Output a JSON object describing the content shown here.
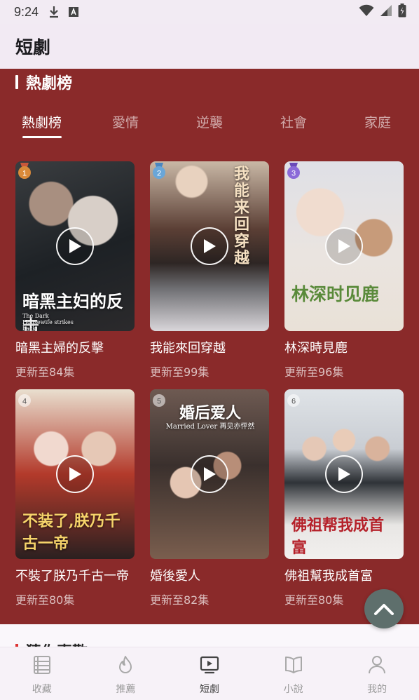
{
  "status_bar": {
    "time": "9:24",
    "icons": [
      "download-icon",
      "a-box-icon",
      "wifi-icon",
      "signal-icon",
      "battery-icon"
    ]
  },
  "app_bar": {
    "title": "短劇"
  },
  "section": {
    "title": "熱劇榜",
    "tabs": [
      {
        "label": "熱劇榜",
        "active": true
      },
      {
        "label": "愛情",
        "active": false
      },
      {
        "label": "逆襲",
        "active": false
      },
      {
        "label": "社會",
        "active": false
      },
      {
        "label": "家庭",
        "active": false
      }
    ]
  },
  "dramas": [
    {
      "rank": "1",
      "title": "暗黑主婦的反擊",
      "update": "更新至84集",
      "poster_text": "暗黑主妇的反击",
      "poster_sub": "The Dark Housewife strikes back"
    },
    {
      "rank": "2",
      "title": "我能來回穿越",
      "update": "更新至99集",
      "poster_text": "我能来回穿越",
      "poster_sub": ""
    },
    {
      "rank": "3",
      "title": "林深時見鹿",
      "update": "更新至96集",
      "poster_text": "林深时见鹿",
      "poster_sub": ""
    },
    {
      "rank": "4",
      "title": "不裝了朕乃千古一帝",
      "update": "更新至80集",
      "poster_text": "不装了,朕乃千古一帝",
      "poster_sub": ""
    },
    {
      "rank": "5",
      "title": "婚後愛人",
      "update": "更新至82集",
      "poster_text": "婚后爱人",
      "poster_sub": "Married Lover 再见亦怦然"
    },
    {
      "rank": "6",
      "title": "佛祖幫我成首富",
      "update": "更新至80集",
      "poster_text": "佛祖帮我成首富",
      "poster_sub": ""
    }
  ],
  "next_section": {
    "title": "猜你喜歡"
  },
  "bottom_nav": [
    {
      "label": "收藏",
      "icon": "bookmark-list-icon",
      "active": false
    },
    {
      "label": "推薦",
      "icon": "flame-icon",
      "active": false
    },
    {
      "label": "短劇",
      "icon": "tv-play-icon",
      "active": true
    },
    {
      "label": "小說",
      "icon": "open-book-icon",
      "active": false
    },
    {
      "label": "我的",
      "icon": "user-icon",
      "active": false
    }
  ],
  "colors": {
    "panel": "#8a2a2a",
    "scroll_top": "#5e6f6c",
    "rank_gold": "#d98a3a",
    "rank_blue": "#6aa6d8",
    "rank_purple": "#8b6ad8"
  }
}
